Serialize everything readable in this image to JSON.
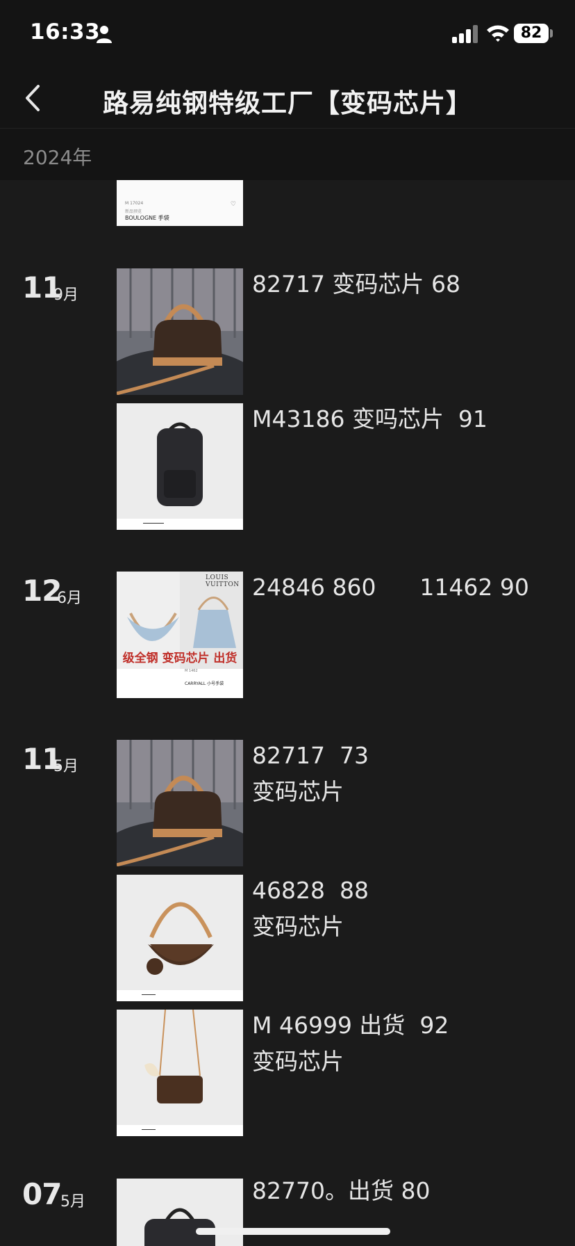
{
  "status_bar": {
    "time": "16:33",
    "battery": "82"
  },
  "nav": {
    "title": "路易纯钢特级工厂【变码芯片】"
  },
  "year": "2024年",
  "top_card": {
    "line1": "M 17024",
    "line2": "新品预览",
    "line3": "BOULOGNE 手袋"
  },
  "posts": [
    {
      "day": "11",
      "month": "9月",
      "items": [
        {
          "caption": "82717 变码芯片 68"
        },
        {
          "caption": "M43186 变吗芯片  91"
        }
      ]
    },
    {
      "day": "12",
      "month": "6月",
      "items": [
        {
          "caption": "24846 860      11462 90",
          "overlay_text": "级全钢 变码芯片 出货",
          "brand": "LOUIS VUITTON",
          "product": "CARRYALL 小号手袋",
          "code": "M 1462"
        }
      ]
    },
    {
      "day": "11",
      "month": "5月",
      "items": [
        {
          "caption": "82717  73\n变码芯片"
        },
        {
          "caption": "46828  88\n变码芯片"
        },
        {
          "caption": "M 46999 出货  92\n变码芯片"
        }
      ]
    },
    {
      "day": "07",
      "month": "5月",
      "items": [
        {
          "caption": "82770。出货 80"
        }
      ]
    }
  ],
  "icons": [
    "person-icon",
    "signal-icon",
    "wifi-icon",
    "back-chevron-icon",
    "heart-icon"
  ]
}
